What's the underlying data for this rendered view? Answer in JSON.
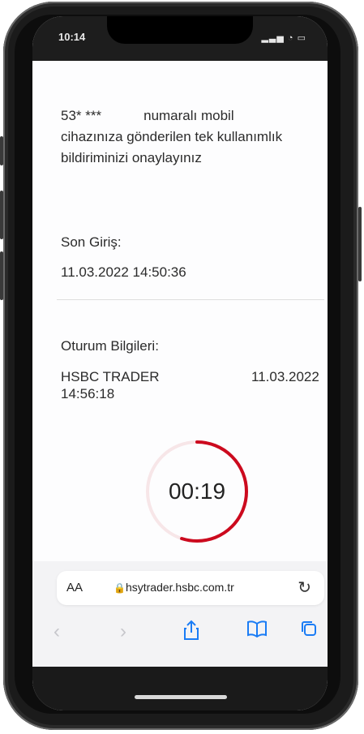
{
  "status": {
    "time": "10:14",
    "system_icons": "▂▃▅ ◔ ▭"
  },
  "content": {
    "message_phone": "53* ***",
    "message_line1": "numaralı mobil",
    "message_line2": "cihazınıza gönderilen tek kullanımlık",
    "message_line3": "bildiriminizi onaylayınız",
    "last_login_label": "Son Giriş:",
    "last_login_value": "11.03.2022 14:50:36",
    "session_label": "Oturum Bilgileri:",
    "session_app": "HSBC TRADER",
    "session_date": "11.03.2022",
    "session_time": "14:56:18"
  },
  "timer": {
    "text": "00:19",
    "progress_fraction": 0.55,
    "accent_color": "#cc0a1e",
    "track_color": "#f7e6e8"
  },
  "browser": {
    "text_size_label": "AA",
    "url": "hsytrader.hsbc.com.tr",
    "lock_icon": "lock-icon",
    "reload_icon": "reload-icon",
    "nav": {
      "back": "‹",
      "forward": "›",
      "share": "share-icon",
      "bookmarks": "book-icon",
      "tabs": "tabs-icon"
    }
  }
}
